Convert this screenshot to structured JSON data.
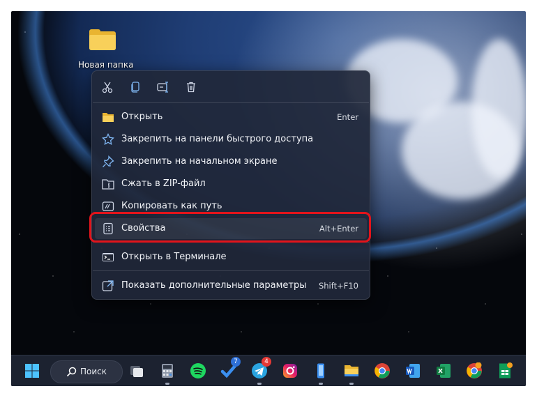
{
  "desktop": {
    "folder_label": "Новая папка"
  },
  "context_menu": {
    "quick_actions": [
      "cut-icon",
      "copy-icon",
      "rename-icon",
      "delete-icon"
    ],
    "items": [
      {
        "label": "Открыть",
        "shortcut": "Enter",
        "icon": "folder-open-icon"
      },
      {
        "label": "Закрепить на панели быстрого доступа",
        "shortcut": "",
        "icon": "star-icon"
      },
      {
        "label": "Закрепить на начальном экране",
        "shortcut": "",
        "icon": "pin-icon"
      },
      {
        "label": "Сжать в ZIP-файл",
        "shortcut": "",
        "icon": "zip-icon"
      },
      {
        "label": "Копировать как путь",
        "shortcut": "",
        "icon": "copy-path-icon"
      },
      {
        "label": "Свойства",
        "shortcut": "Alt+Enter",
        "icon": "properties-icon",
        "highlighted": true
      },
      {
        "label": "Открыть в Терминале",
        "shortcut": "",
        "icon": "terminal-icon"
      },
      {
        "label": "Показать дополнительные параметры",
        "shortcut": "Shift+F10",
        "icon": "more-options-icon"
      }
    ]
  },
  "taskbar": {
    "search_label": "Поиск",
    "badges": {
      "todo": "7",
      "telegram": "4"
    },
    "icons": [
      "start-icon",
      "task-view-icon",
      "calculator-icon",
      "spotify-icon",
      "todo-icon",
      "telegram-icon",
      "instagram-icon",
      "phone-link-icon",
      "file-explorer-icon",
      "chrome-icon",
      "word-icon",
      "excel-icon",
      "chrome-canary-icon",
      "sheets-icon"
    ]
  },
  "colors": {
    "highlight_border": "#e3141b",
    "menu_bg": "#20283a"
  }
}
